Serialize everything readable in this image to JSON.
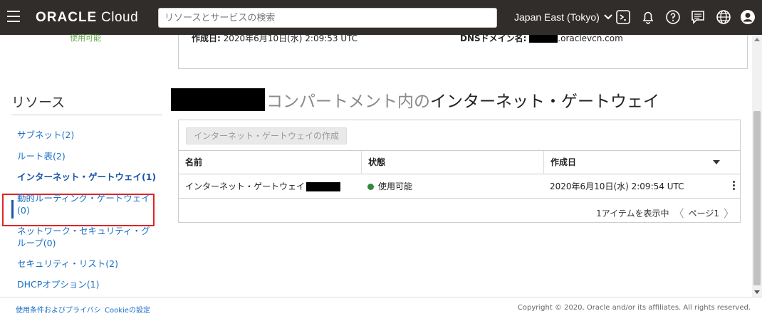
{
  "header": {
    "logo_bold": "ORACLE",
    "logo_light": "Cloud",
    "search_placeholder": "リソースとサービスの検索",
    "region": "Japan East (Tokyo)",
    "icons": [
      "cloud-shell-icon",
      "bell-icon",
      "help-icon",
      "chat-icon",
      "globe-icon",
      "user-icon"
    ]
  },
  "left": {
    "top_status": "使用可能",
    "resources_title": "リソース",
    "items": [
      {
        "label": "サブネット(2)"
      },
      {
        "label": "ルート表(2)"
      },
      {
        "label": "インターネット・ゲートウェイ(1)",
        "active": true
      },
      {
        "label_line1": "動的ルーティング・ゲートウェイ",
        "label_line2": "(0)"
      },
      {
        "label_line1": "ネットワーク・セキュリティ・グ",
        "label_line2": "ループ(0)"
      },
      {
        "label": "セキュリティ・リスト(2)"
      },
      {
        "label": "DHCPオプション(1)"
      }
    ]
  },
  "details": {
    "created_label": "作成日:",
    "created_value": "2020年6月10日(水) 2:09:53 UTC",
    "dns_label": "DNSドメイン名:",
    "dns_value": ".oraclevcn.com"
  },
  "main": {
    "heading_grey": "コンパートメント内の",
    "heading_dark": "インターネット・ゲートウェイ",
    "create_button": "インターネット・ゲートウェイの作成",
    "columns": [
      "名前",
      "状態",
      "作成日"
    ],
    "rows": [
      {
        "name": "インターネット・ゲートウェイ",
        "status": "使用可能",
        "created": "2020年6月10日(水) 2:09:54 UTC"
      }
    ],
    "pager_count": "1アイテムを表示中",
    "pager_page": "ページ1"
  },
  "footer": {
    "terms": "使用条件およびプライバシ",
    "cookie": "Cookieの設定",
    "copyright": "Copyright © 2020, Oracle and/or its affiliates. All rights reserved."
  },
  "colors": {
    "topbar": "#312d2a",
    "link": "#1a6fc6",
    "status_green": "#2e8b3a",
    "highlight_red": "#e02424"
  }
}
